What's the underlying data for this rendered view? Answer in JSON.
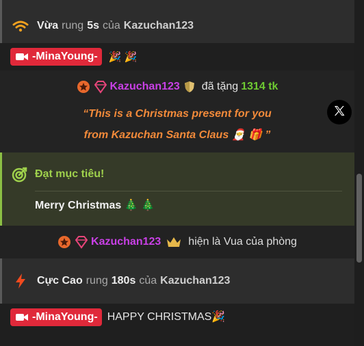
{
  "vibe1": {
    "user": "Vừa",
    "verb": "rung",
    "duration": "5s",
    "of": "của",
    "name": "Kazuchan123"
  },
  "chat1": {
    "badge": "-MinaYoung-",
    "emoji": "🎉 🎉"
  },
  "gift": {
    "user": "Kazuchan123",
    "text": "đã tặng",
    "amount": "1314 tk",
    "quote_line1": "“This is a Christmas present for you",
    "quote_line2": "from Kazuchan Santa Claus 🎅 🎁 ”"
  },
  "goal": {
    "title": "Đạt mục tiêu!",
    "message": "Merry Christmas 🎄 🎄"
  },
  "king": {
    "user": "Kazuchan123",
    "text": "hiện là Vua của phòng"
  },
  "vibe2": {
    "user": "Cực Cao",
    "verb": "rung",
    "duration": "180s",
    "of": "của",
    "name": "Kazuchan123"
  },
  "chat2": {
    "badge": "-MinaYoung-",
    "message": "HAPPY CHRISTMAS🎉"
  },
  "colors": {
    "badge_red": "#e0293a",
    "gift_purple": "#c940e6",
    "amount_green": "#6ecb32",
    "quote_orange": "#f28a3a",
    "goal_green": "#9fd14c"
  }
}
